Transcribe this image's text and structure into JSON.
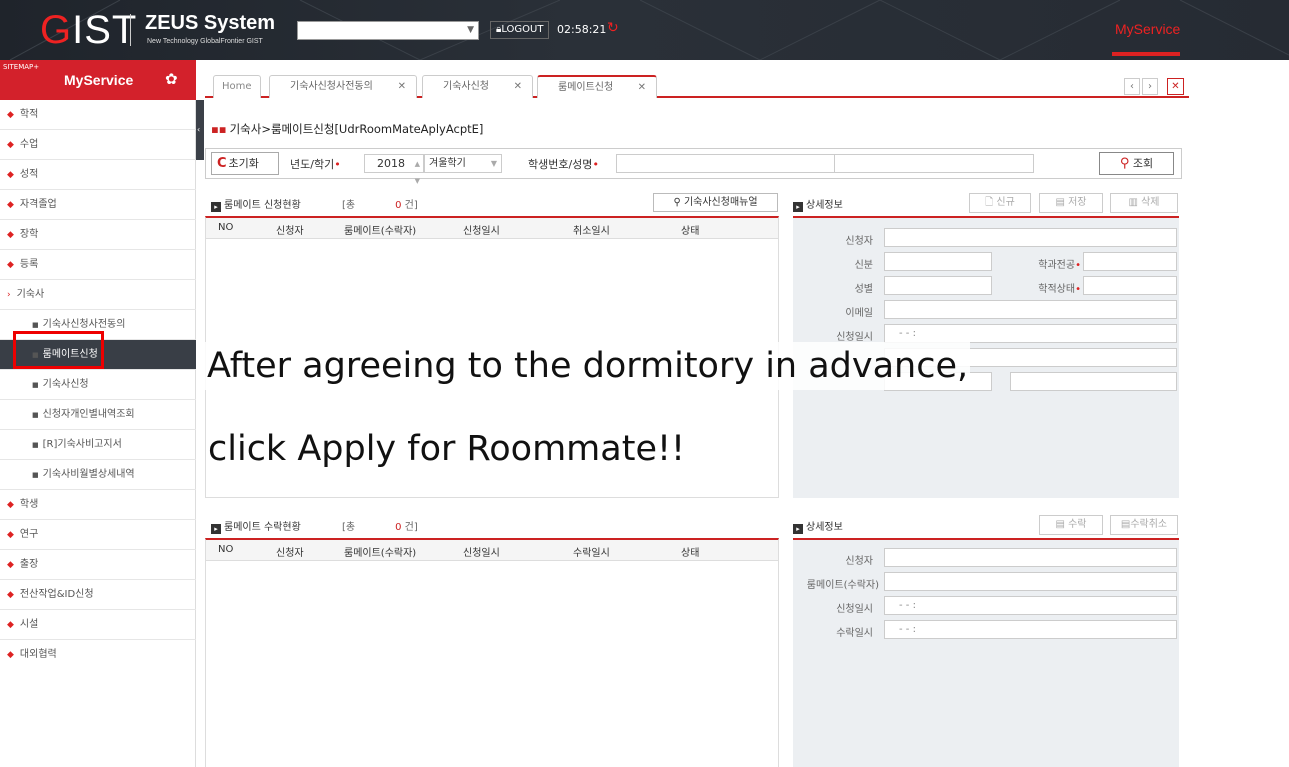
{
  "header": {
    "logo_g": "G",
    "logo_rest": "IST",
    "system_title": "ZEUS System",
    "system_subtitle": "New Technology GlobalFrontier GIST",
    "logout_label": "LOGOUT",
    "clock": "02:58:21",
    "myservice": "MyService"
  },
  "sidebar": {
    "sitemap": "SITEMAP+",
    "title": "MyService",
    "items": [
      {
        "label": "학적"
      },
      {
        "label": "수업"
      },
      {
        "label": "성적"
      },
      {
        "label": "자격졸업"
      },
      {
        "label": "장학"
      },
      {
        "label": "등록"
      },
      {
        "label": "기숙사"
      }
    ],
    "subitems": [
      {
        "label": "기숙사신청사전동의"
      },
      {
        "label": "룸메이트신청"
      },
      {
        "label": "기숙사신청"
      },
      {
        "label": "신청자개인별내역조회"
      },
      {
        "label": "[R]기숙사비고지서"
      },
      {
        "label": "기숙사비월별상세내역"
      }
    ],
    "items2": [
      {
        "label": "학생"
      },
      {
        "label": "연구"
      },
      {
        "label": "출장"
      },
      {
        "label": "전산작업&ID신청"
      },
      {
        "label": "시설"
      },
      {
        "label": "대외협력"
      }
    ]
  },
  "tabs": [
    {
      "label": "Home"
    },
    {
      "label": "기숙사신청사전동의"
    },
    {
      "label": "기숙사신청"
    },
    {
      "label": "룸메이트신청"
    }
  ],
  "breadcrumb": "기숙사>룸메이트신청[UdrRoomMateAplyAcptE]",
  "search": {
    "reset_label": "초기화",
    "year_term_label": "년도/학기",
    "year_value": "2018",
    "term_value": "겨울학기",
    "student_label": "학생번호/성명",
    "search_label": "조회"
  },
  "apply_panel": {
    "title": "룸메이트 신청현황",
    "total_prefix": "[총",
    "total_count": "0",
    "total_suffix": "건]",
    "manual_button": "기숙사신청매뉴얼",
    "columns": [
      "NO",
      "신청자",
      "룸메이트(수락자)",
      "신청일시",
      "취소일시",
      "상태"
    ]
  },
  "apply_detail": {
    "title": "상세정보",
    "new_label": "신규",
    "save_label": "저장",
    "delete_label": "삭제",
    "fields": {
      "applicant": "신청자",
      "status_type": "신분",
      "dept": "학과전공",
      "gender": "성별",
      "enroll_status": "학적상태",
      "email": "이메일",
      "apply_date": "신청일시",
      "date_placeholder": "- -  :"
    }
  },
  "accept_panel": {
    "title": "룸메이트 수락현황",
    "total_prefix": "[총",
    "total_count": "0",
    "total_suffix": "건]",
    "columns": [
      "NO",
      "신청자",
      "룸메이트(수락자)",
      "신청일시",
      "수락일시",
      "상태"
    ]
  },
  "accept_detail": {
    "title": "상세정보",
    "accept_label": "수락",
    "cancel_accept_label": "수락취소",
    "fields": {
      "applicant": "신청자",
      "roommate": "룸메이트(수락자)",
      "apply_date": "신청일시",
      "accept_date": "수락일시",
      "date_placeholder": "- -  :"
    }
  },
  "overlay": {
    "line1": "After agreeing to the dormitory in advance,",
    "line2": "click Apply for Roommate!!"
  },
  "colors": {
    "accent": "#d3212b",
    "header": "#262b33"
  }
}
